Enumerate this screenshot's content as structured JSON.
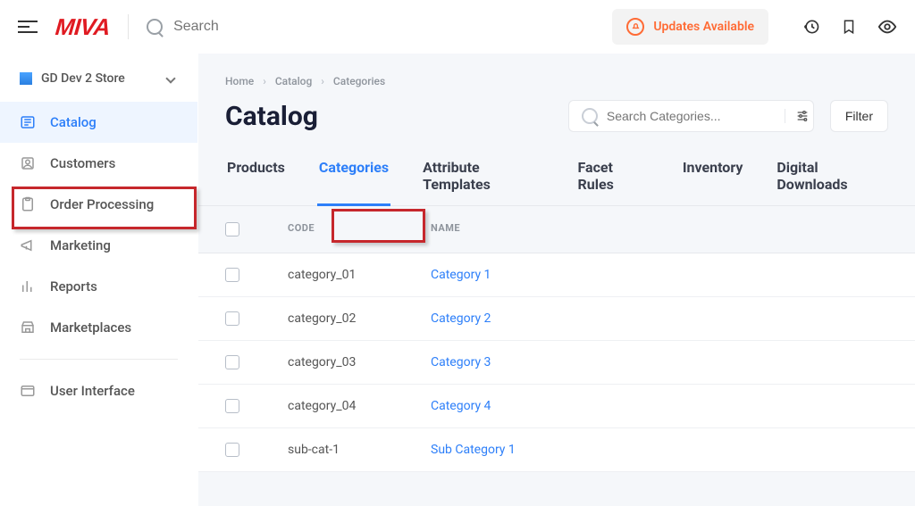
{
  "topbar": {
    "search_placeholder": "Search",
    "updates_label": "Updates Available"
  },
  "store": {
    "name": "GD Dev 2 Store"
  },
  "sidebar": {
    "items": [
      {
        "label": "Catalog",
        "active": true
      },
      {
        "label": "Customers"
      },
      {
        "label": "Order Processing"
      },
      {
        "label": "Marketing"
      },
      {
        "label": "Reports"
      },
      {
        "label": "Marketplaces"
      }
    ],
    "footer": [
      {
        "label": "User Interface"
      }
    ]
  },
  "breadcrumbs": [
    "Home",
    "Catalog",
    "Categories"
  ],
  "page_title": "Catalog",
  "search_categories_placeholder": "Search Categories...",
  "filter_label": "Filter",
  "tabs": [
    {
      "label": "Products"
    },
    {
      "label": "Categories",
      "active": true
    },
    {
      "label": "Attribute Templates"
    },
    {
      "label": "Facet Rules"
    },
    {
      "label": "Inventory"
    },
    {
      "label": "Digital Downloads"
    }
  ],
  "table": {
    "headers": {
      "code": "CODE",
      "name": "NAME"
    },
    "rows": [
      {
        "code": "category_01",
        "name": "Category 1"
      },
      {
        "code": "category_02",
        "name": "Category 2"
      },
      {
        "code": "category_03",
        "name": "Category 3"
      },
      {
        "code": "category_04",
        "name": "Category 4"
      },
      {
        "code": "sub-cat-1",
        "name": "Sub Category 1"
      }
    ]
  }
}
